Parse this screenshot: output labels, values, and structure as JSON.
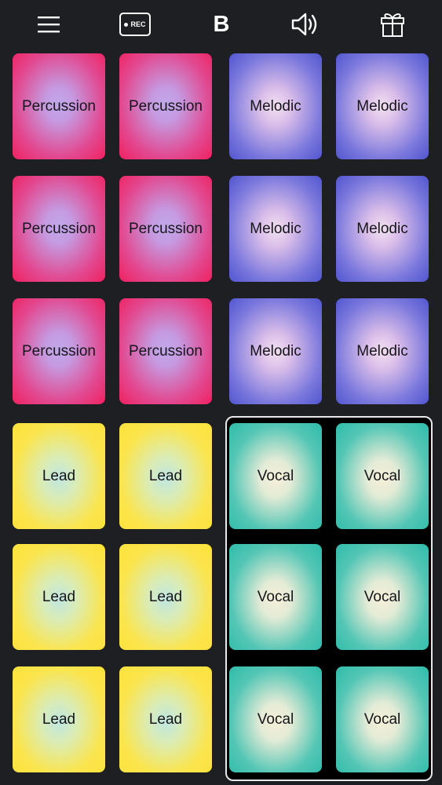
{
  "toolbar": {
    "rec_label": "REC",
    "bank_label": "B",
    "icons": [
      "menu-icon",
      "record-icon",
      "speaker-icon",
      "gift-icon"
    ]
  },
  "pads": {
    "percussion": "Percussion",
    "melodic": "Melodic",
    "lead": "Lead",
    "vocal": "Vocal"
  },
  "colors": {
    "background": "#1e1f23",
    "percussion": "#f02160",
    "melodic": "#5156cf",
    "lead": "#fde23a",
    "vocal": "#2fbcab"
  }
}
